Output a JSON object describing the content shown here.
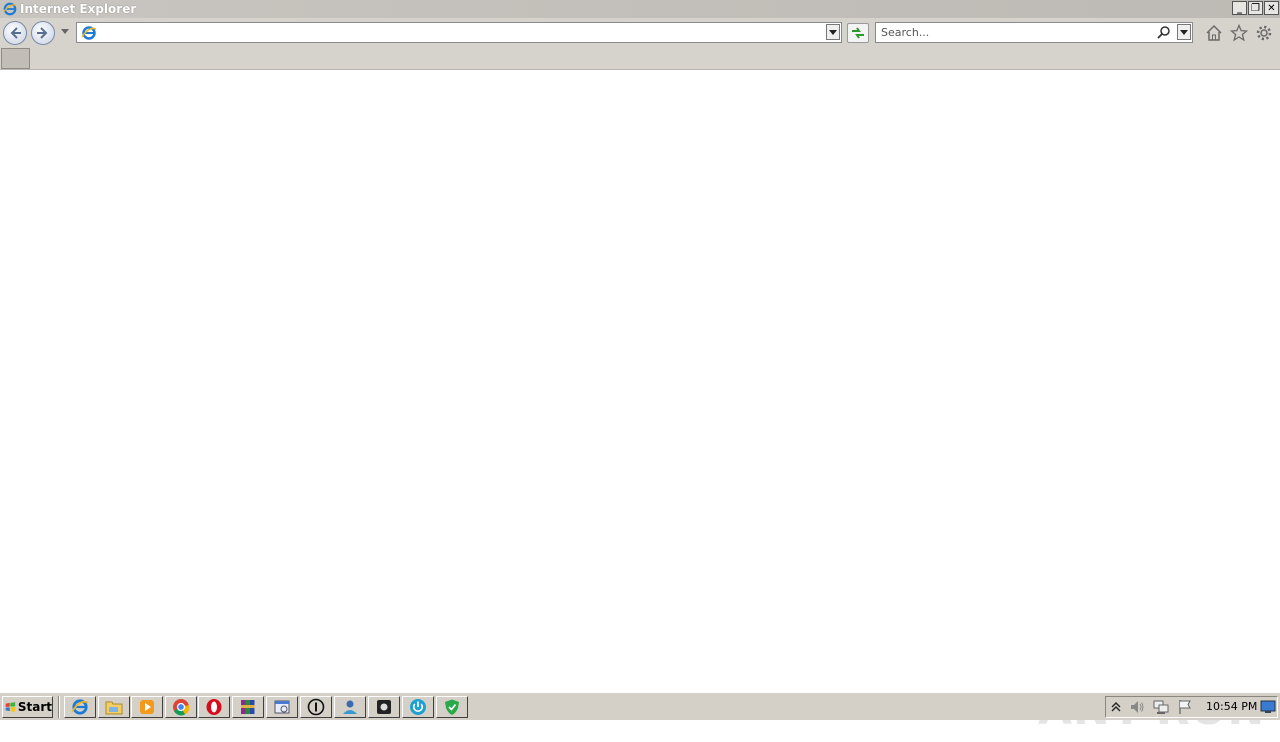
{
  "window": {
    "title": "Internet Explorer",
    "minimize_label": "_",
    "restore_label": "❐",
    "close_label": "✕"
  },
  "navbar": {
    "address_value": "",
    "search_placeholder": "Search..."
  },
  "taskbar": {
    "start_label": "Start",
    "clock": "10:54 PM",
    "pinned": [
      "internet-explorer",
      "windows-explorer",
      "windows-media-player",
      "google-chrome",
      "opera",
      "winrar",
      "remote-desktop",
      "ccleaner",
      "user-app",
      "disk-app",
      "power-app",
      "shield-app"
    ]
  },
  "watermark": {
    "text_left": "ANY",
    "text_right": "RUN"
  },
  "colors": {
    "chrome_bg": "#d6d2cc",
    "taskbar_bg": "#d4d0c8",
    "ie_blue": "#1e7bd6",
    "ie_gold": "#f2b81e"
  }
}
